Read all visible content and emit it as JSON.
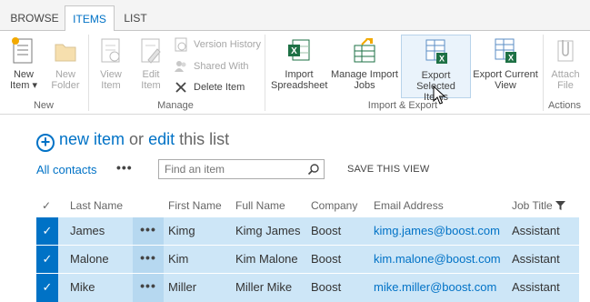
{
  "tabs": [
    {
      "label": "BROWSE"
    },
    {
      "label": "ITEMS"
    },
    {
      "label": "LIST"
    }
  ],
  "ribbon": {
    "groups": {
      "new": "New",
      "manage": "Manage",
      "import_export": "Import & Export",
      "actions": "Actions"
    },
    "new_item": {
      "line1": "New",
      "line2": "Item ▾"
    },
    "new_folder": {
      "line1": "New",
      "line2": "Folder"
    },
    "view_item": {
      "line1": "View",
      "line2": "Item"
    },
    "edit_item": {
      "line1": "Edit",
      "line2": "Item"
    },
    "version_history": "Version History",
    "shared_with": "Shared With",
    "delete_item": "Delete Item",
    "import_spreadsheet": {
      "line1": "Import",
      "line2": "Spreadsheet"
    },
    "manage_import_jobs": {
      "line1": "Manage Import",
      "line2": "Jobs"
    },
    "export_selected": {
      "line1": "Export Selected",
      "line2": "Items"
    },
    "export_current": {
      "line1": "Export Current",
      "line2": "View"
    },
    "attach_file": {
      "line1": "Attach",
      "line2": "File"
    }
  },
  "title": {
    "new_item": "new item",
    "or": "or",
    "edit": "edit",
    "rest": "this list"
  },
  "view": {
    "name": "All contacts",
    "menu": "•••",
    "search_placeholder": "Find an item",
    "save_view": "SAVE THIS VIEW"
  },
  "table": {
    "headers": {
      "check": "✓",
      "last_name": "Last Name",
      "first_name": "First Name",
      "full_name": "Full Name",
      "company": "Company",
      "email": "Email Address",
      "job_title": "Job Title"
    },
    "rows": [
      {
        "last": "James",
        "first": "Kimg",
        "full": "Kimg James",
        "company": "Boost",
        "email": "kimg.james@boost.com",
        "job": "Assistant"
      },
      {
        "last": "Malone",
        "first": "Kim",
        "full": "Kim Malone",
        "company": "Boost",
        "email": "kim.malone@boost.com",
        "job": "Assistant"
      },
      {
        "last": "Mike",
        "first": "Miller",
        "full": "Miller Mike",
        "company": "Boost",
        "email": "mike.miller@boost.com",
        "job": "Assistant"
      }
    ],
    "row_check": "✓",
    "row_menu": "•••"
  },
  "colors": {
    "accent": "#0072c6",
    "selected_row": "#cde6f7",
    "excel_green": "#1e7145"
  }
}
